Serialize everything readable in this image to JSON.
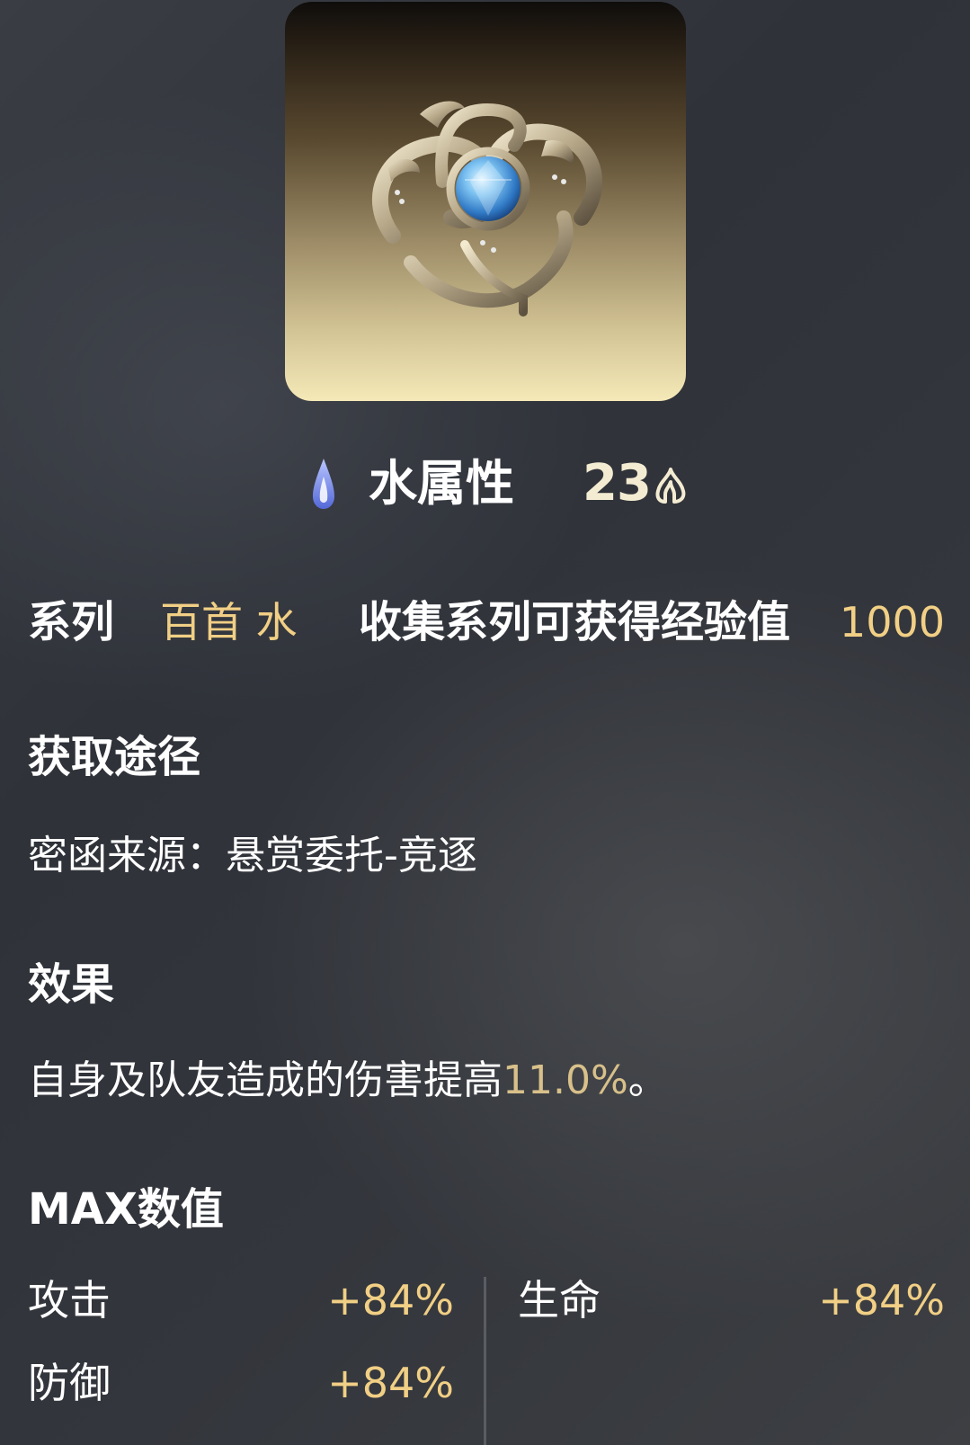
{
  "card": {
    "icon": "ornate-silver-brooch-with-blue-gem"
  },
  "attribute": {
    "icon": "water-drop-icon",
    "name": "水属性",
    "level": "23",
    "level_icon": "flame-icon"
  },
  "series": {
    "label": "系列",
    "value": "百首 水",
    "exp_label": "收集系列可获得经验值",
    "exp_value": "1000"
  },
  "acquisition": {
    "heading": "获取途径",
    "text": "密函来源：悬赏委托-竞逐"
  },
  "effect": {
    "heading": "效果",
    "text_prefix": "自身及队友造成的伤害提高",
    "highlight": "11.0%",
    "text_suffix": "。"
  },
  "max_values": {
    "heading": "MAX数值",
    "stats": [
      {
        "label": "攻击",
        "value": "+84%"
      },
      {
        "label": "生命",
        "value": "+84%"
      },
      {
        "label": "防御",
        "value": "+84%"
      }
    ]
  },
  "colors": {
    "accent_gold": "#f1cf85",
    "highlight_gold": "#d8c08a",
    "water_blue": "#7d95f0"
  }
}
